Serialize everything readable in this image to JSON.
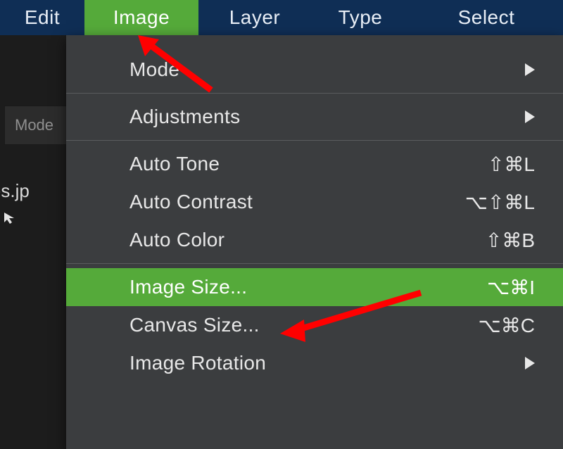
{
  "menubar": {
    "edit": "Edit",
    "image": "Image",
    "layer": "Layer",
    "type": "Type",
    "select": "Select"
  },
  "left": {
    "mode_tab": "Mode",
    "filename": "unes.jp"
  },
  "dropdown": {
    "items": [
      {
        "label": "Mode",
        "submenu": true
      },
      {
        "sep": true
      },
      {
        "label": "Adjustments",
        "submenu": true
      },
      {
        "sep": true
      },
      {
        "label": "Auto Tone",
        "shortcut": "⇧⌘L"
      },
      {
        "label": "Auto Contrast",
        "shortcut": "⌥⇧⌘L"
      },
      {
        "label": "Auto Color",
        "shortcut": "⇧⌘B"
      },
      {
        "sep": true
      },
      {
        "label": "Image Size...",
        "shortcut": "⌥⌘I",
        "highlight": true
      },
      {
        "label": "Canvas Size...",
        "shortcut": "⌥⌘C"
      },
      {
        "label": "Image Rotation",
        "submenu": true
      }
    ]
  },
  "annotations": {
    "arrow1_target": "menu-image",
    "arrow2_target": "menuitem-image-size"
  }
}
